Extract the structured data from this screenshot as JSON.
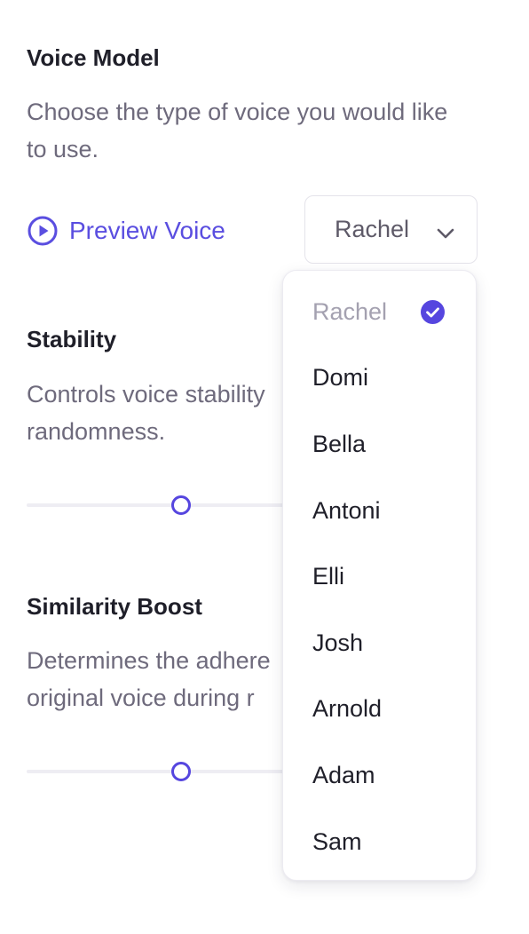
{
  "voice_model": {
    "title": "Voice Model",
    "description": "Choose the type of voice you would like to use.",
    "preview_label": "Preview Voice",
    "preview_icon": "play-circle-icon",
    "selected_voice": "Rachel",
    "dropdown_icon": "chevron-down-icon",
    "options": [
      {
        "label": "Rachel",
        "selected": true
      },
      {
        "label": "Domi",
        "selected": false
      },
      {
        "label": "Bella",
        "selected": false
      },
      {
        "label": "Antoni",
        "selected": false
      },
      {
        "label": "Elli",
        "selected": false
      },
      {
        "label": "Josh",
        "selected": false
      },
      {
        "label": "Arnold",
        "selected": false
      },
      {
        "label": "Adam",
        "selected": false
      },
      {
        "label": "Sam",
        "selected": false
      }
    ],
    "selected_icon": "check-circle-icon"
  },
  "stability": {
    "title": "Stability",
    "description_line1": "Controls voice stability",
    "description_line2": "randomness.",
    "value_fraction": 0.58
  },
  "similarity_boost": {
    "title": "Similarity Boost",
    "description_line1": "Determines the adhere",
    "description_line2": "original voice during r",
    "value_fraction": 0.58
  },
  "colors": {
    "accent": "#5646df",
    "heading": "#1f1f29",
    "muted_text": "#6e6a7c",
    "selected_option_text": "#a4a1b0",
    "track": "#eeedf3"
  }
}
